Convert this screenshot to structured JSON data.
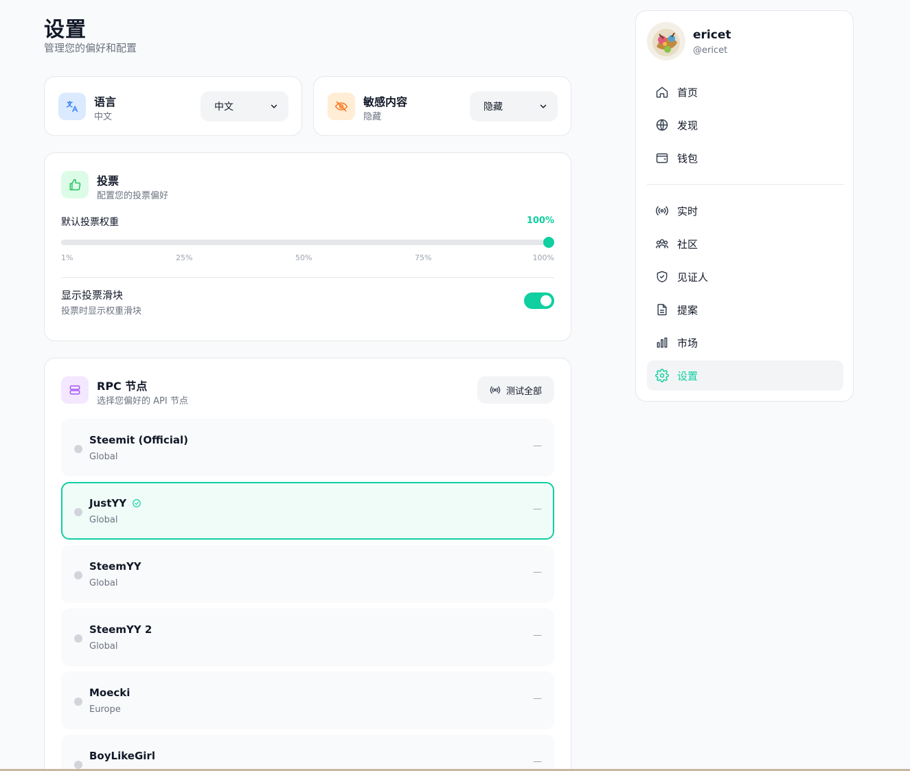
{
  "header": {
    "title": "设置",
    "subtitle": "管理您的偏好和配置"
  },
  "language": {
    "title": "语言",
    "current": "中文",
    "selected": "中文",
    "icon": "translate-icon"
  },
  "sensitive": {
    "title": "敏感内容",
    "current": "隐藏",
    "selected": "隐藏",
    "icon": "eye-off-icon"
  },
  "voting": {
    "title": "投票",
    "subtitle": "配置您的投票偏好",
    "weight_label": "默认投票权重",
    "weight_value_text": "100%",
    "weight_fraction": 1.0,
    "ticks": [
      "1%",
      "25%",
      "50%",
      "75%",
      "100%"
    ],
    "show_slider_label": "显示投票滑块",
    "show_slider_desc": "投票时显示权重滑块",
    "show_slider_on": true
  },
  "rpc": {
    "title": "RPC 节点",
    "subtitle": "选择您偏好的 API 节点",
    "test_all_label": "测试全部",
    "nodes": [
      {
        "name": "Steemit (Official)",
        "region": "Global",
        "status": "—",
        "active": false
      },
      {
        "name": "JustYY",
        "region": "Global",
        "status": "—",
        "active": true
      },
      {
        "name": "SteemYY",
        "region": "Global",
        "status": "—",
        "active": false
      },
      {
        "name": "SteemYY 2",
        "region": "Global",
        "status": "—",
        "active": false
      },
      {
        "name": "Moecki",
        "region": "Europe",
        "status": "—",
        "active": false
      },
      {
        "name": "BoyLikeGirl",
        "region": "",
        "status": "—",
        "active": false
      }
    ]
  },
  "user": {
    "name": "ericet",
    "handle": "@ericet"
  },
  "nav": {
    "primary": [
      {
        "label": "首页",
        "icon": "home-icon"
      },
      {
        "label": "发现",
        "icon": "globe-icon"
      },
      {
        "label": "钱包",
        "icon": "wallet-icon"
      }
    ],
    "secondary": [
      {
        "label": "实时",
        "icon": "live-icon"
      },
      {
        "label": "社区",
        "icon": "users-icon"
      },
      {
        "label": "见证人",
        "icon": "shield-icon"
      },
      {
        "label": "提案",
        "icon": "document-icon"
      },
      {
        "label": "市场",
        "icon": "bar-chart-icon"
      },
      {
        "label": "设置",
        "icon": "gear-icon",
        "active": true
      }
    ]
  },
  "colors": {
    "accent": "#10cfa0",
    "accent_bg": "#effcf8",
    "purple": "#a855f7",
    "orange": "#f97316",
    "blue": "#3b82f6"
  }
}
